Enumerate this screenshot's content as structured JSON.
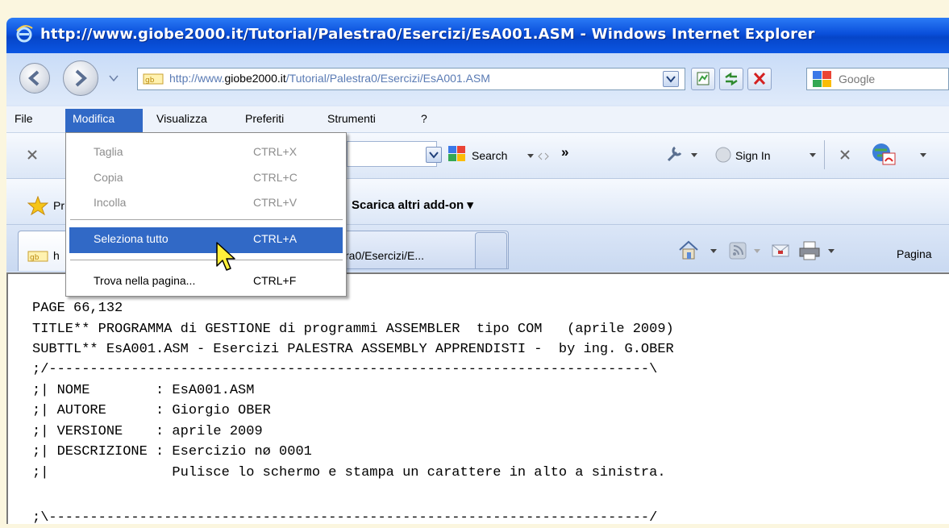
{
  "window": {
    "title": "http://www.giobe2000.it/Tutorial/Palestra0/Esercizi/EsA001.ASM - Windows Internet Explorer"
  },
  "address_bar": {
    "url_prefix": "http://www.",
    "url_domain": "giobe2000.it",
    "url_suffix": "/Tutorial/Palestra0/Esercizi/EsA001.ASM"
  },
  "search_box": {
    "placeholder": "Google"
  },
  "menubar": {
    "items": [
      "File",
      "Modifica",
      "Visualizza",
      "Preferiti",
      "Strumenti",
      "?"
    ]
  },
  "toolbar": {
    "search_label": "Search",
    "signin_label": "Sign In",
    "favorites_partial": "Pr",
    "addons_label": "Scarica altri add-on",
    "chevron": "»"
  },
  "tabs": {
    "tab1_partial": "h",
    "tab2_partial": "ra0/Esercizi/E...",
    "page_label": "Pagina"
  },
  "edit_menu": {
    "items": [
      {
        "label": "Taglia",
        "shortcut": "CTRL+X",
        "enabled": false
      },
      {
        "label": "Copia",
        "shortcut": "CTRL+C",
        "enabled": false
      },
      {
        "label": "Incolla",
        "shortcut": "CTRL+V",
        "enabled": false
      },
      {
        "label": "Seleziona tutto",
        "shortcut": "CTRL+A",
        "enabled": true,
        "highlighted": true
      },
      {
        "label": "Trova nella pagina...",
        "shortcut": "CTRL+F",
        "enabled": true
      }
    ]
  },
  "content": {
    "lines": [
      "PAGE 66,132",
      "TITLE** PROGRAMMA di GESTIONE di programmi ASSEMBLER  tipo COM   (aprile 2009)",
      "SUBTTL** EsA001.ASM - Esercizi PALESTRA ASSEMBLY APPRENDISTI -  by ing. G.OBER",
      ";/-------------------------------------------------------------------------\\",
      ";| NOME        : EsA001.ASM",
      ";| AUTORE      : Giorgio OBER",
      ";| VERSIONE    : aprile 2009",
      ";| DESCRIZIONE : Esercizio nø 0001",
      ";|               Pulisce lo schermo e stampa un carattere in alto a sinistra.",
      ";\\-------------------------------------------------------------------------/"
    ]
  },
  "colors": {
    "titlebar": "#0a4fdb",
    "menu_highlight": "#3169c6"
  }
}
